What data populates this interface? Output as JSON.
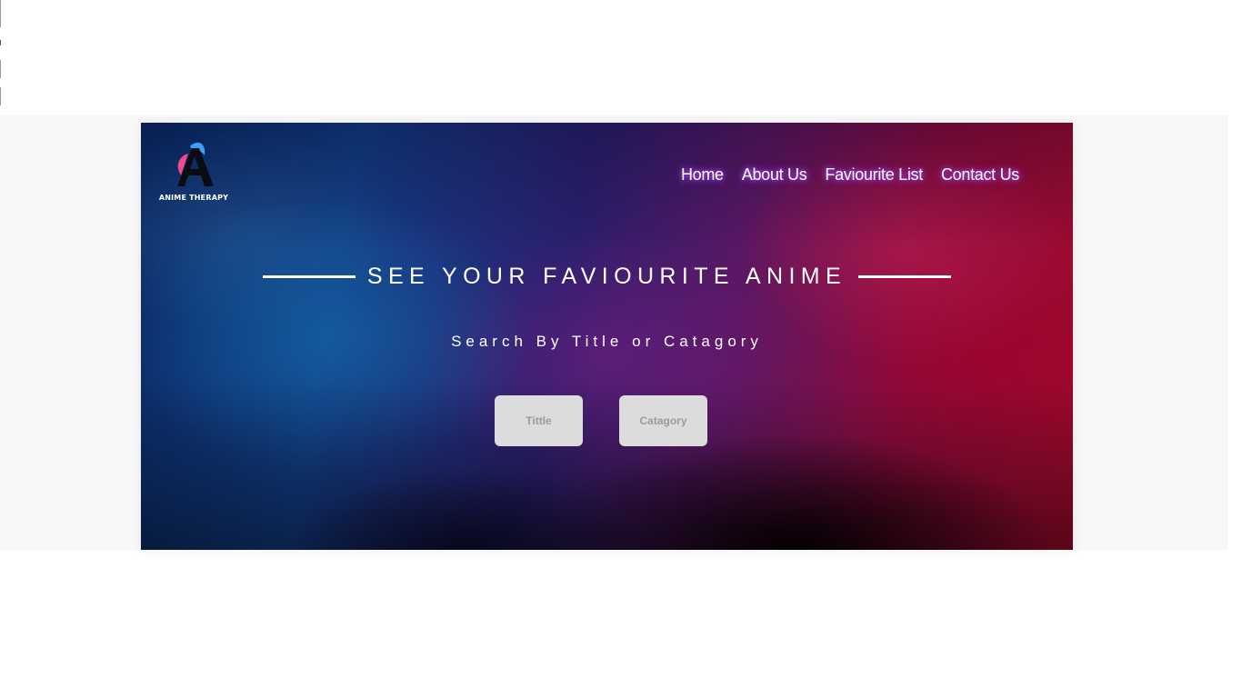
{
  "brand": {
    "name": "ANIME THERAPY",
    "logo_icon": "anime-therapy-logo-icon",
    "colors": {
      "accent_pink": "#f04a8a",
      "accent_blue": "#3aa0ff",
      "logo_dark": "#0b0b14"
    }
  },
  "nav": {
    "items": [
      {
        "label": "Home"
      },
      {
        "label": "About Us"
      },
      {
        "label": "Faviourite List"
      },
      {
        "label": "Contact Us"
      }
    ],
    "glow_color": "#b050ff"
  },
  "hero": {
    "headline": "SEE YOUR FAVIOURITE ANIME",
    "subheadline": "Search By Title or Catagory",
    "buttons": {
      "title_label": "Tittle",
      "category_label": "Catagory"
    },
    "colors": {
      "left": "#123d86",
      "middle": "#5a1763",
      "right": "#a20a2c",
      "button_bg": "#dcdcdc",
      "button_text": "#9a9a9a"
    }
  }
}
